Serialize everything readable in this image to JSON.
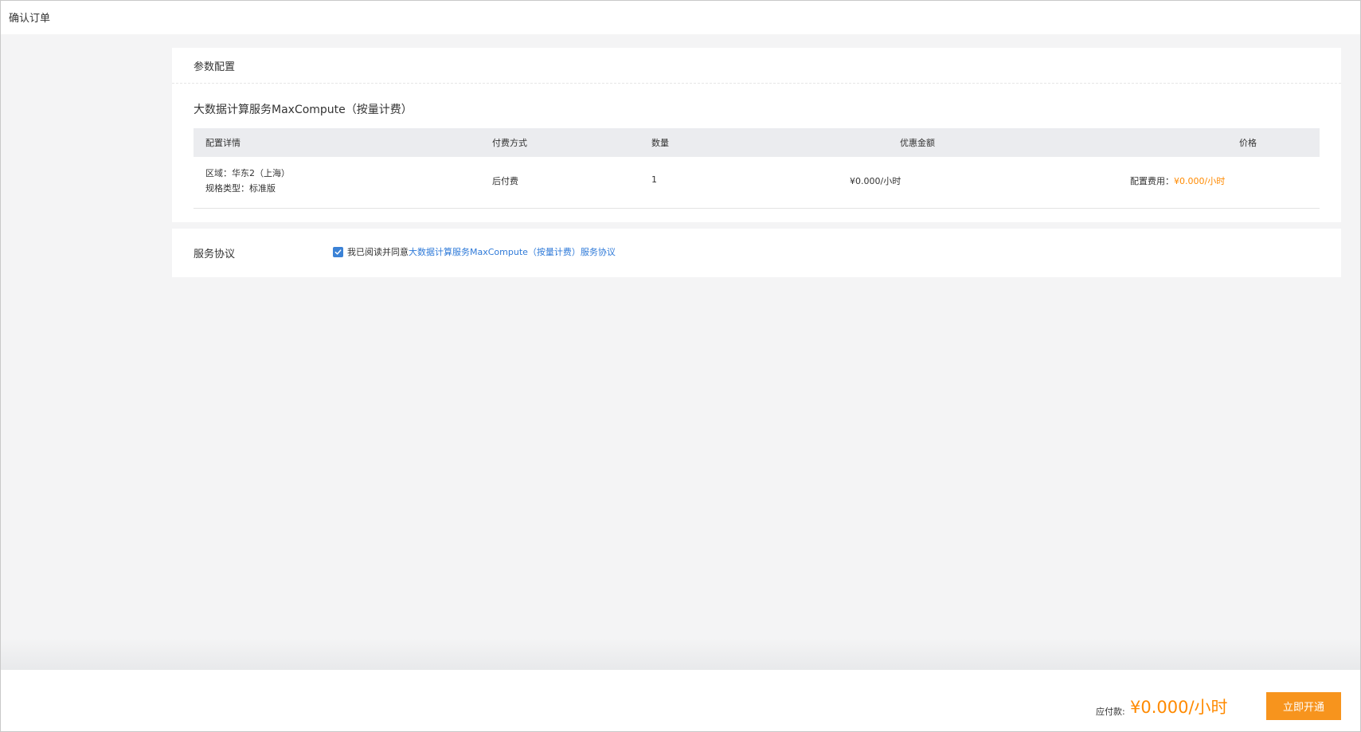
{
  "header": {
    "title": "确认订单"
  },
  "params": {
    "section_title": "参数配置",
    "product_name": "大数据计算服务MaxCompute（按量计费）",
    "table": {
      "headers": {
        "detail": "配置详情",
        "payment": "付费方式",
        "quantity": "数量",
        "discount": "优惠金额",
        "price": "价格"
      },
      "row": {
        "region": "区域：华东2（上海）",
        "spec": "规格类型：标准版",
        "payment": "后付费",
        "quantity": "1",
        "discount": "¥0.000/小时",
        "price_label": "配置费用：",
        "price_value": "¥0.000/小时"
      }
    }
  },
  "agreement": {
    "label": "服务协议",
    "checked": true,
    "prefix": "我已阅读并同意",
    "link": "大数据计算服务MaxCompute（按量计费）服务协议"
  },
  "footer": {
    "total_label": "应付款:",
    "total_amount": "¥0.000/小时",
    "submit_label": "立即开通"
  },
  "colors": {
    "accent_orange": "#ff8a00",
    "button_orange": "#f7941d",
    "link_blue": "#2f7ad8",
    "checkbox_blue": "#3b82d6",
    "page_bg": "#f4f4f5"
  }
}
